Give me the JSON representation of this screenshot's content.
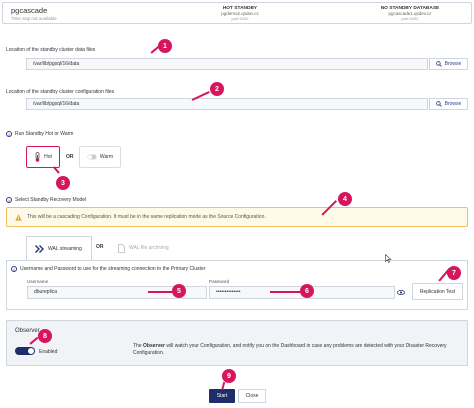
{
  "header": {
    "app_name": "pgcascade",
    "app_sub": "Time Sap not available",
    "hot_standby": {
      "title": "HOT STANDBY",
      "host": "pgdemo2.qsdev.cz",
      "port": "port 5432"
    },
    "no_standby": {
      "title": "NO STANDBY DATABASE",
      "host": "pgcascade1.qsdev.cz",
      "port": "port 5432"
    }
  },
  "data_files": {
    "label": "Location of the standby cluster data files",
    "value": "/var/lib/pgsql/16/data",
    "browse": "Browse"
  },
  "config_files": {
    "label": "Location of the standby cluster configuration files",
    "value": "/var/lib/pgsql/16/data",
    "browse": "Browse"
  },
  "run_mode": {
    "label": "Run Standby Hot or Warm",
    "hot": "Hot",
    "or": "OR",
    "warm": "Warm"
  },
  "recovery": {
    "label": "Select Standby Recovery Model",
    "warning": "This will be a cascading Configuration. It must be in the same replication mode as the Source Configuration.",
    "tab_wal_streaming": "WAL streaming",
    "or": "OR",
    "tab_wal_archiving": "WAL file archiving"
  },
  "streaming": {
    "label": "Username and Password to use for the streaming connection to the Primary Cluster",
    "username_label": "Username",
    "username_value": "dbureplica",
    "password_label": "Password",
    "password_value": "••••••••••••••",
    "replication_test": "Replication Test"
  },
  "observer": {
    "title": "Observer",
    "toggle_label": "Enabled",
    "desc_pre": "The ",
    "desc_bold": "Observer",
    "desc_post": " will watch your Configuration, and notify you on the Dashboard in case any problems are detected with your Disaster Recovery Configuration."
  },
  "footer": {
    "start": "Start",
    "close": "Close"
  },
  "badges": [
    "1",
    "2",
    "3",
    "4",
    "5",
    "6",
    "7",
    "8",
    "9"
  ],
  "colors": {
    "accent": "#1f2d6b",
    "badge": "#d6165c",
    "warning_border": "#f0c060",
    "warning_icon": "#e0a020"
  },
  "icons": {
    "browse": "search-icon",
    "hot": "thermometer-icon",
    "warm": "toggle-switch-icon",
    "warning": "warning-triangle-icon",
    "wal_streaming": "double-chevron-right-icon",
    "wal_archiving": "file-icon",
    "password": "eye-icon",
    "info": "info-circle-icon"
  }
}
